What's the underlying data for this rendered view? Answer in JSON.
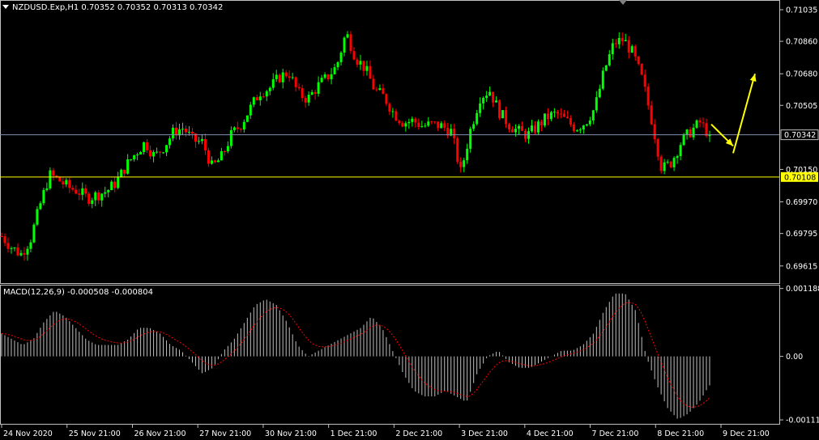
{
  "header": {
    "symbol_label": "NZDUSD.Exp,H1  0.70352 0.70352 0.70313 0.70342",
    "macd_label": "MACD(12,26,9) -0.000508 -0.000804"
  },
  "colors": {
    "background": "#000000",
    "bull_candle": "#00ff00",
    "bear_candle": "#ff0000",
    "bid_line": "#8090b0",
    "support_line": "#ffff00",
    "arrow": "#ffff00",
    "macd_hist": "#c0c0c0",
    "macd_signal": "#ff0000",
    "axis": "#c0c0c0"
  },
  "chart_data": {
    "type": "candlestick",
    "timeframe": "H1",
    "price_axis": {
      "range": [
        0.6952,
        0.7108
      ],
      "ticks": [
        "0.71035",
        "0.70860",
        "0.70680",
        "0.70505",
        "0.70150",
        "0.69970",
        "0.69795",
        "0.69615"
      ]
    },
    "time_axis": {
      "ticks": [
        "24 Nov 2020",
        "25 Nov 21:00",
        "26 Nov 21:00",
        "27 Nov 21:00",
        "30 Nov 21:00",
        "1 Dec 21:00",
        "2 Dec 21:00",
        "3 Dec 21:00",
        "4 Dec 21:00",
        "7 Dec 21:00",
        "8 Dec 21:00",
        "9 Dec 21:00"
      ]
    },
    "current_price": {
      "value": 0.70342,
      "label": "0.70342"
    },
    "horizontal_line": {
      "value": 0.70108,
      "label": "0.70108"
    },
    "close_path": [
      0.6978,
      0.6972,
      0.6968,
      0.6976,
      0.6995,
      0.7012,
      0.7009,
      0.7005,
      0.7003,
      0.6999,
      0.7001,
      0.7003,
      0.7008,
      0.7017,
      0.7024,
      0.703,
      0.7022,
      0.7028,
      0.7036,
      0.7038,
      0.7031,
      0.703,
      0.7016,
      0.7022,
      0.7034,
      0.704,
      0.7049,
      0.7058,
      0.706,
      0.7066,
      0.7069,
      0.7057,
      0.7054,
      0.7061,
      0.7066,
      0.7072,
      0.7091,
      0.7077,
      0.7071,
      0.7059,
      0.7055,
      0.7046,
      0.7041,
      0.7042,
      0.7039,
      0.704,
      0.7039,
      0.7036,
      0.7013,
      0.7037,
      0.7055,
      0.7059,
      0.7047,
      0.704,
      0.7036,
      0.7034,
      0.7039,
      0.7044,
      0.7046,
      0.7042,
      0.7038,
      0.7041,
      0.7049,
      0.707,
      0.7085,
      0.7087,
      0.7079,
      0.7064,
      0.7041,
      0.7015,
      0.7019,
      0.703,
      0.7036,
      0.7041,
      0.7034
    ],
    "annotation_arrows": [
      {
        "from": [
          0.704,
          0.7024
        ],
        "to": [
          0.7028,
          0.7024
        ]
      },
      {
        "from": [
          0.7024,
          0.7024
        ],
        "to": [
          0.7068,
          0.7068
        ]
      }
    ],
    "macd": {
      "params": "MACD(12,26,9)",
      "main": -0.000508,
      "signal": -0.000804,
      "axis_ticks": [
        "0.001188",
        "0.00",
        "-0.001111"
      ],
      "range": [
        -0.00118,
        0.00124
      ],
      "histogram_path": [
        0.0004,
        0.0003,
        0.0002,
        0.0003,
        0.0006,
        0.0008,
        0.0007,
        0.0005,
        0.0003,
        0.0002,
        0.0002,
        0.0002,
        0.0003,
        0.0005,
        0.0005,
        0.0004,
        0.0002,
        0.0001,
        -0.0001,
        -0.0003,
        -0.0002,
        0.0001,
        0.0003,
        0.0006,
        0.0009,
        0.001,
        0.0009,
        0.0006,
        0.0002,
        0.0,
        0.0001,
        0.0002,
        0.0003,
        0.0004,
        0.0005,
        0.0007,
        0.0005,
        0.0001,
        -0.0003,
        -0.0006,
        -0.0007,
        -0.0007,
        -0.0006,
        -0.0007,
        -0.0008,
        -0.0003,
        0.0,
        0.0001,
        -0.0001,
        -0.0002,
        -0.0002,
        -0.0001,
        0.0,
        0.0001,
        0.0001,
        0.0002,
        0.0004,
        0.0008,
        0.0011,
        0.0011,
        0.0008,
        0.0,
        -0.0005,
        -0.0009,
        -0.0011,
        -0.001,
        -0.0008,
        -0.0005
      ]
    }
  }
}
